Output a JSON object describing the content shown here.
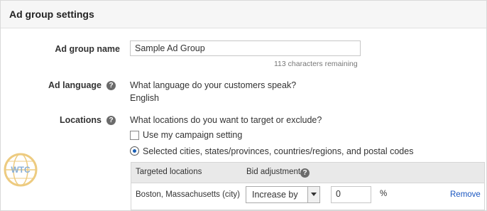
{
  "header": {
    "title": "Ad group settings"
  },
  "ad_group_name": {
    "label": "Ad group name",
    "value": "Sample Ad Group",
    "chars_remaining": "113 characters remaining"
  },
  "ad_language": {
    "label": "Ad language",
    "help_icon": "question-icon",
    "question": "What language do your customers speak?",
    "value": "English"
  },
  "locations": {
    "label": "Locations",
    "help_icon": "question-icon",
    "question": "What locations do you want to target or exclude?",
    "option_campaign": "Use my campaign setting",
    "option_campaign_checked": false,
    "option_selected": "Selected cities, states/provinces, countries/regions, and postal codes",
    "option_selected_checked": true,
    "table": {
      "headers": {
        "targeted": "Targeted locations",
        "bid": "Bid adjustment"
      },
      "rows": [
        {
          "location": "Boston, Massachusetts (city)",
          "adjust_type": "Increase by",
          "adjust_value": "0",
          "unit": "%",
          "action": "Remove"
        }
      ]
    }
  },
  "watermark": {
    "text": "WTC"
  },
  "colors": {
    "accent": "#1a56c0",
    "header_bg": "#f6f6f6",
    "table_head_bg": "#e9e9e9"
  }
}
